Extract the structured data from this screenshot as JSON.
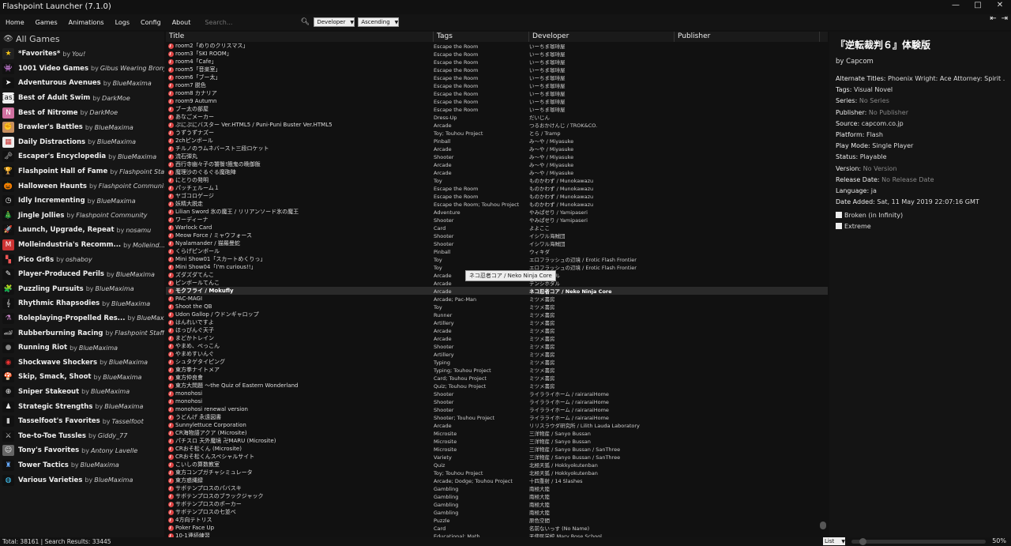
{
  "window": {
    "title": "Flashpoint Launcher (7.1.0)",
    "controls": [
      "—",
      "□",
      "✕"
    ]
  },
  "menu": [
    "Home",
    "Games",
    "Animations",
    "Logs",
    "Config",
    "About"
  ],
  "search": {
    "placeholder": "Search...",
    "value": ""
  },
  "order_by": {
    "selected": "Developer"
  },
  "order_dir": {
    "selected": "Ascending"
  },
  "sidebar": {
    "all_games": "All Games",
    "playlists": [
      {
        "name": "*Favorites*",
        "author": "You!",
        "icon": "star-icon",
        "bg": "#222",
        "glyph": "★",
        "color": "#f5c518"
      },
      {
        "name": "1001 Video Games",
        "author": "Gibus Wearing Brony",
        "icon": "space-invader-icon",
        "bg": "#111",
        "glyph": "👾",
        "color": "#fff"
      },
      {
        "name": "Adventurous Avenues",
        "author": "BlueMaxima",
        "icon": "cursor-icon",
        "bg": "#111",
        "glyph": "➤",
        "color": "#fff"
      },
      {
        "name": "Best of Adult Swim",
        "author": "DarkMoe",
        "icon": "adult-swim-icon",
        "bg": "#eee",
        "glyph": "[as]",
        "color": "#111"
      },
      {
        "name": "Best of Nitrome",
        "author": "DarkMoe",
        "icon": "nitrome-icon",
        "bg": "#d070a0",
        "glyph": "N",
        "color": "#fff"
      },
      {
        "name": "Brawler's Battles",
        "author": "BlueMaxima",
        "icon": "fist-icon",
        "bg": "#c89060",
        "glyph": "✊",
        "color": "#fff"
      },
      {
        "name": "Daily Distractions",
        "author": "BlueMaxima",
        "icon": "calendar-icon",
        "bg": "#eee",
        "glyph": "▦",
        "color": "#c33"
      },
      {
        "name": "Escaper's Encyclopedia",
        "author": "BlueMaxima",
        "icon": "key-icon",
        "bg": "#111",
        "glyph": "🗝",
        "color": "#ccc"
      },
      {
        "name": "Flashpoint Hall of Fame",
        "author": "Flashpoint Staff",
        "icon": "trophy-icon",
        "bg": "#111",
        "glyph": "🏆",
        "color": "#f5c518"
      },
      {
        "name": "Halloween Haunts",
        "author": "Flashpoint Community",
        "icon": "pumpkin-icon",
        "bg": "#111",
        "glyph": "🎃",
        "color": "#f80"
      },
      {
        "name": "Idly Incrementing",
        "author": "BlueMaxima",
        "icon": "clock-icon",
        "bg": "#111",
        "glyph": "◷",
        "color": "#eee"
      },
      {
        "name": "Jingle Jollies",
        "author": "Flashpoint Community",
        "icon": "tree-icon",
        "bg": "#111",
        "glyph": "🎄",
        "color": "#2a2"
      },
      {
        "name": "Launch, Upgrade, Repeat",
        "author": "nosamu",
        "icon": "rocket-icon",
        "bg": "#111",
        "glyph": "🚀",
        "color": "#ccc"
      },
      {
        "name": "Molleindustria's Recomm...",
        "author": "Molleind...",
        "icon": "molleindustria-icon",
        "bg": "#c33",
        "glyph": "M",
        "color": "#fff"
      },
      {
        "name": "Pico Gr8s",
        "author": "oshaboy",
        "icon": "pico-icon",
        "bg": "#111",
        "glyph": "▚",
        "color": "#e55"
      },
      {
        "name": "Player-Produced Perils",
        "author": "BlueMaxima",
        "icon": "edit-icon",
        "bg": "#111",
        "glyph": "✎",
        "color": "#eee"
      },
      {
        "name": "Puzzling Pursuits",
        "author": "BlueMaxima",
        "icon": "puzzle-icon",
        "bg": "#111",
        "glyph": "🧩",
        "color": "#e33"
      },
      {
        "name": "Rhythmic Rhapsodies",
        "author": "BlueMaxima",
        "icon": "music-note-icon",
        "bg": "#111",
        "glyph": "𝄞",
        "color": "#eee"
      },
      {
        "name": "Roleplaying-Propelled Res...",
        "author": "BlueMaxi...",
        "icon": "potion-icon",
        "bg": "#111",
        "glyph": "⚗",
        "color": "#c8c"
      },
      {
        "name": "Rubberburning Racing",
        "author": "Flashpoint Staff",
        "icon": "racing-icon",
        "bg": "#111",
        "glyph": "🏎",
        "color": "#ccc"
      },
      {
        "name": "Running Riot",
        "author": "BlueMaxima",
        "icon": "grenade-icon",
        "bg": "#111",
        "glyph": "●",
        "color": "#888"
      },
      {
        "name": "Shockwave Shockers",
        "author": "BlueMaxima",
        "icon": "shockwave-icon",
        "bg": "#111",
        "glyph": "◉",
        "color": "#e33"
      },
      {
        "name": "Skip, Smack, Shoot",
        "author": "BlueMaxima",
        "icon": "mario-icon",
        "bg": "#111",
        "glyph": "🍄",
        "color": "#e33"
      },
      {
        "name": "Sniper Stakeout",
        "author": "BlueMaxima",
        "icon": "crosshair-icon",
        "bg": "#111",
        "glyph": "⊕",
        "color": "#eee"
      },
      {
        "name": "Strategic Strengths",
        "author": "BlueMaxima",
        "icon": "chess-icon",
        "bg": "#111",
        "glyph": "♟",
        "color": "#eee"
      },
      {
        "name": "Tasselfoot's Favorites",
        "author": "Tasselfoot",
        "icon": "bookmark-icon",
        "bg": "#111",
        "glyph": "▮",
        "color": "#ccc"
      },
      {
        "name": "Toe-to-Toe Tussles",
        "author": "Giddy_77",
        "icon": "fighter-icon",
        "bg": "#111",
        "glyph": "⚔",
        "color": "#ccc"
      },
      {
        "name": "Tony's Favorites",
        "author": "Antony Lavelle",
        "icon": "avatar-icon",
        "bg": "#666",
        "glyph": "☺",
        "color": "#eee"
      },
      {
        "name": "Tower Tactics",
        "author": "BlueMaxima",
        "icon": "tower-icon",
        "bg": "#111",
        "glyph": "♜",
        "color": "#6af"
      },
      {
        "name": "Various Varieties",
        "author": "BlueMaxima",
        "icon": "globe-icon",
        "bg": "#111",
        "glyph": "◍",
        "color": "#4cf"
      }
    ]
  },
  "table": {
    "headers": {
      "title": "Title",
      "tags": "Tags",
      "developer": "Developer",
      "publisher": "Publisher"
    },
    "rows": [
      {
        "t": "room2「めりのクリスマス」",
        "tags": "Escape the Room",
        "dev": "いーちま珈琲屋"
      },
      {
        "t": "room3「SKI ROOM」",
        "tags": "Escape the Room",
        "dev": "いーちま珈琲屋"
      },
      {
        "t": "room4「Cafe」",
        "tags": "Escape the Room",
        "dev": "いーちま珈琲屋"
      },
      {
        "t": "room5「音楽室」",
        "tags": "Escape the Room",
        "dev": "いーちま珈琲屋"
      },
      {
        "t": "room6「ブー太」",
        "tags": "Escape the Room",
        "dev": "いーちま珈琲屋"
      },
      {
        "t": "room7 脱色",
        "tags": "Escape the Room",
        "dev": "いーちま珈琲屋"
      },
      {
        "t": "room8 カナリア",
        "tags": "Escape the Room",
        "dev": "いーちま珈琲屋"
      },
      {
        "t": "room9 Autumn",
        "tags": "Escape the Room",
        "dev": "いーちま珈琲屋"
      },
      {
        "t": "ブー太の部屋",
        "tags": "Escape the Room",
        "dev": "いーちま珈琲屋"
      },
      {
        "t": "あなごメーカー",
        "tags": "Dress-Up",
        "dev": "だいじん"
      },
      {
        "t": "ぷにぷにバスター Ver.HTML5 / Puni-Puni Buster Ver.HTML5",
        "tags": "Arcade",
        "dev": "つるおかけんじ / TROK&CO."
      },
      {
        "t": "うずうずナズー",
        "tags": "Toy; Touhou Project",
        "dev": "とら / Tramp"
      },
      {
        "t": "2chピンボール",
        "tags": "Pinball",
        "dev": "み〜や / Miyasuke"
      },
      {
        "t": "チルノのラムネバースト三段ロケット",
        "tags": "Arcade",
        "dev": "み〜や / Miyasuke"
      },
      {
        "t": "流石弾丸",
        "tags": "Shooter",
        "dev": "み〜や / Miyasuke"
      },
      {
        "t": "西行寺幽々子の饕餮!餓鬼の晩御飯",
        "tags": "Arcade",
        "dev": "み〜や / Miyasuke"
      },
      {
        "t": "魔理沙のぐるぐる魔砲陣",
        "tags": "Arcade",
        "dev": "み〜や / Miyasuke"
      },
      {
        "t": "にとりの発明",
        "tags": "Toy",
        "dev": "ものかわず / Munokawazu"
      },
      {
        "t": "パッチェルーム１",
        "tags": "Escape the Room",
        "dev": "ものかわず / Munokawazu"
      },
      {
        "t": "ヤゴコロゲージ",
        "tags": "Escape the Room",
        "dev": "ものかわず / Munokawazu"
      },
      {
        "t": "妖精大脱走",
        "tags": "Escape the Room; Touhou Project",
        "dev": "ものかわず / Munokawazu"
      },
      {
        "t": "Lilian Sword 氷の魔王 / リリアンソード氷の魔王",
        "tags": "Adventure",
        "dev": "やみぱせり / Yamipaseri"
      },
      {
        "t": "ワーディーナ",
        "tags": "Shooter",
        "dev": "やみぱせり / Yamipaseri"
      },
      {
        "t": "Warlock Card",
        "tags": "Card",
        "dev": "よよここ"
      },
      {
        "t": "Meow Force / ミャウフォース",
        "tags": "Shooter",
        "dev": "イシワル海賊団"
      },
      {
        "t": "Nyalamander / 猫羅曼蛇",
        "tags": "Shooter",
        "dev": "イシワル海賊団"
      },
      {
        "t": "くらげピンボール",
        "tags": "Pinball",
        "dev": "ウィキダ"
      },
      {
        "t": "Mini Show01「スカートめくりっ」",
        "tags": "Toy",
        "dev": "エロフラッシュの辺境 / Erotic Flash Frontier"
      },
      {
        "t": "Mini Show04「I'm curious!!」",
        "tags": "Toy",
        "dev": "エロフラッシュの辺境 / Erotic Flash Frontier"
      },
      {
        "t": "ズダズダてんこ",
        "tags": "Arcade",
        "dev": "テンシホタル"
      },
      {
        "t": "ピンボールてんこ",
        "tags": "Arcade",
        "dev": "テンシホタル"
      },
      {
        "t": "モクフライ / Mokufly",
        "tags": "Arcade",
        "dev": "ネコ忍者コア / Neko Ninja Core",
        "sel": true
      },
      {
        "t": "PAC-MAGI",
        "tags": "Arcade; Pac-Man",
        "dev": "ミツメ書房"
      },
      {
        "t": "Shoot the QB",
        "tags": "Toy",
        "dev": "ミツメ書房"
      },
      {
        "t": "Udon Gallop / ウドンギャロップ",
        "tags": "Runner",
        "dev": "ミツメ書房"
      },
      {
        "t": "はんれいですよ",
        "tags": "Artillery",
        "dev": "ミツメ書房"
      },
      {
        "t": "ほっぴんぐ天子",
        "tags": "Arcade",
        "dev": "ミツメ書房"
      },
      {
        "t": "まどかトレイン",
        "tags": "Arcade",
        "dev": "ミツメ書房"
      },
      {
        "t": "やまめ、ぺっこん",
        "tags": "Shooter",
        "dev": "ミツメ書房"
      },
      {
        "t": "やまめすいんぐ",
        "tags": "Artillery",
        "dev": "ミツメ書房"
      },
      {
        "t": "シュタゲタイピング",
        "tags": "Typing",
        "dev": "ミツメ書房"
      },
      {
        "t": "東方拳ナイトメア",
        "tags": "Typing; Touhou Project",
        "dev": "ミツメ書房"
      },
      {
        "t": "東方仲良會",
        "tags": "Card; Touhou Project",
        "dev": "ミツメ書房"
      },
      {
        "t": "東方大問題 ～the Quiz of Eastern Wonderland",
        "tags": "Quiz; Touhou Project",
        "dev": "ミツメ書房"
      },
      {
        "t": "monohosi",
        "tags": "Shooter",
        "dev": "ライラライホーム / rairaraiHome"
      },
      {
        "t": "monohosi",
        "tags": "Shooter",
        "dev": "ライラライホーム / rairaraiHome"
      },
      {
        "t": "monohosi renewal version",
        "tags": "Shooter",
        "dev": "ライラライホーム / rairaraiHome"
      },
      {
        "t": "うどんげ 永遠図書",
        "tags": "Shooter; Touhou Project",
        "dev": "ライラライホーム / rairaraiHome"
      },
      {
        "t": "Sunnylettuce Corporation",
        "tags": "Arcade",
        "dev": "リリスラウダ研究所 / Lilith Lauda Laboratory"
      },
      {
        "t": "CR海物語アクア (Microsite)",
        "tags": "Microsite",
        "dev": "三洋物産 / Sanyo Bussan"
      },
      {
        "t": "パチスロ 天外魔境 卍MARU (Microsite)",
        "tags": "Microsite",
        "dev": "三洋物産 / Sanyo Bussan"
      },
      {
        "t": "CRおそ松くん (Microsite)",
        "tags": "Microsite",
        "dev": "三洋物産 / Sanyo Bussan / SanThree"
      },
      {
        "t": "CRおそ松くんスペシャルサイト",
        "tags": "Variety",
        "dev": "三洋物産 / Sanyo Bussan / SanThree"
      },
      {
        "t": "こいしの算数教室",
        "tags": "Quiz",
        "dev": "北極天狐 / Hokkyokutenban"
      },
      {
        "t": "東方コンプガチャシミュレータ",
        "tags": "Toy; Touhou Project",
        "dev": "北極天狐 / Hokkyokutenban"
      },
      {
        "t": "東方惑縄録",
        "tags": "Arcade; Dodge; Touhou Project",
        "dev": "十四重射 / 14 Slashes"
      },
      {
        "t": "サボテンプロスのパバスキ",
        "tags": "Gambling",
        "dev": "南極大陸"
      },
      {
        "t": "サボテンプロスのブラックジャック",
        "tags": "Gambling",
        "dev": "南極大陸"
      },
      {
        "t": "サボテンプロスのポーカー",
        "tags": "Gambling",
        "dev": "南極大陸"
      },
      {
        "t": "サボテンプロスの七並べ",
        "tags": "Gambling",
        "dev": "南極大陸"
      },
      {
        "t": "4方向テトリス",
        "tags": "Puzzle",
        "dev": "原色空間"
      },
      {
        "t": "Poker Face Up",
        "tags": "Card",
        "dev": "名前ないっす (No Name)"
      },
      {
        "t": "10-1連続練習",
        "tags": "Educational; Math",
        "dev": "天使民学校 Mary Rose School"
      }
    ]
  },
  "tooltip": "ネコ忍者コア / Neko Ninja Core",
  "detail": {
    "title": "『逆転裁判６』体験版",
    "by": "by Capcom",
    "fields": [
      {
        "k": "Alternate Titles:",
        "v": "Phoenix Wright: Ace Attorney: Spirit ...",
        "muted": false
      },
      {
        "k": "Tags:",
        "v": "Visual Novel",
        "muted": false
      },
      {
        "k": "Series:",
        "v": "No Series",
        "muted": true
      },
      {
        "k": "Publisher:",
        "v": "No Publisher",
        "muted": true
      },
      {
        "k": "Source:",
        "v": "capcom.co.jp",
        "muted": false
      },
      {
        "k": "Platform:",
        "v": "Flash",
        "muted": false
      },
      {
        "k": "Play Mode:",
        "v": "Single Player",
        "muted": false
      },
      {
        "k": "Status:",
        "v": "Playable",
        "muted": false
      },
      {
        "k": "Version:",
        "v": "No Version",
        "muted": true
      },
      {
        "k": "Release Date:",
        "v": "No Release Date",
        "muted": true
      },
      {
        "k": "Language:",
        "v": "ja",
        "muted": false
      },
      {
        "k": "Date Added:",
        "v": " Sat, 11 May 2019 22:07:16 GMT",
        "muted": false
      }
    ],
    "checks": [
      {
        "label": "Broken (in Infinity)",
        "checked": false
      },
      {
        "label": "Extreme",
        "checked": false
      }
    ]
  },
  "status": {
    "text": "Total: 38161  |  Search Results: 33445",
    "view": "List",
    "zoom": "50%"
  }
}
